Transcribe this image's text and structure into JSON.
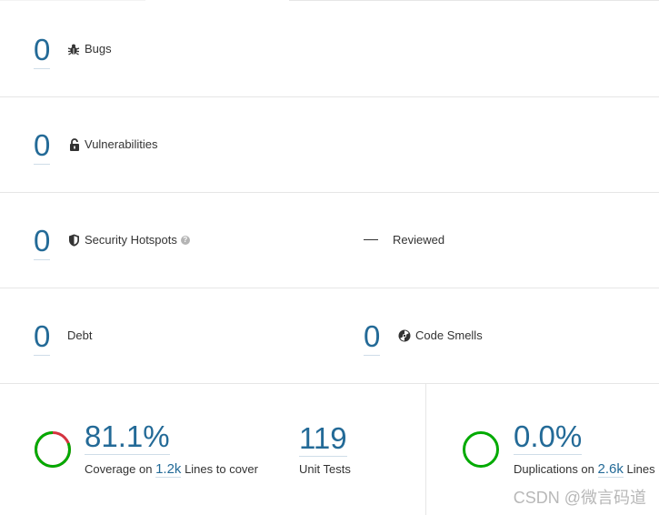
{
  "bugs": {
    "value": "0",
    "label": "Bugs"
  },
  "vulnerabilities": {
    "value": "0",
    "label": "Vulnerabilities"
  },
  "security_hotspots": {
    "value": "0",
    "label": "Security Hotspots",
    "help": "?",
    "reviewed_value": "—",
    "reviewed_label": "Reviewed"
  },
  "debt": {
    "value": "0",
    "label": "Debt"
  },
  "code_smells": {
    "value": "0",
    "label": "Code Smells"
  },
  "coverage": {
    "percent": "81.1%",
    "percent_value": 81.1,
    "label_prefix": "Coverage on",
    "lines": "1.2k",
    "label_suffix": "Lines to cover",
    "covered_color": "#00aa00",
    "uncovered_color": "#d4333f"
  },
  "unit_tests": {
    "value": "119",
    "label": "Unit Tests"
  },
  "duplications": {
    "percent": "0.0%",
    "percent_value": 0.0,
    "label_prefix": "Duplications on",
    "lines": "2.6k",
    "label_suffix": "Lines",
    "color": "#00aa00"
  },
  "watermark": "CSDN @微言码道",
  "colors": {
    "accent": "#236a97",
    "border": "#e6e6e6",
    "text": "#333333"
  }
}
